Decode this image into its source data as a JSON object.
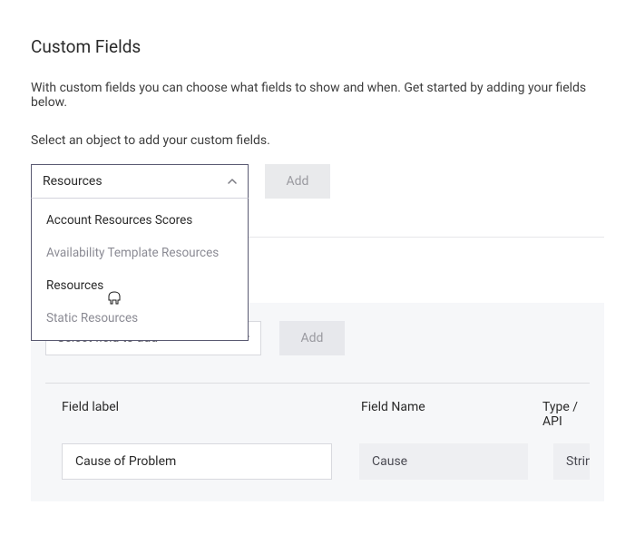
{
  "title": "Custom Fields",
  "description": "With custom fields you can choose what fields to show and when. Get started by adding your fields below.",
  "subdescription": "Select an object to add your custom fields.",
  "object_select": {
    "selected": "Resources",
    "add_label": "Add",
    "options": [
      "Account Resources Scores",
      "Availability Template Resources",
      "Resources",
      "Static Resources"
    ]
  },
  "panel": {
    "field_select_placeholder": "Select field to add",
    "add_label": "Add",
    "columns": {
      "label": "Field label",
      "name": "Field Name",
      "type": "Type / API"
    },
    "rows": [
      {
        "label": "Cause of Problem",
        "name": "Cause",
        "type": "String / Cause__"
      }
    ]
  }
}
